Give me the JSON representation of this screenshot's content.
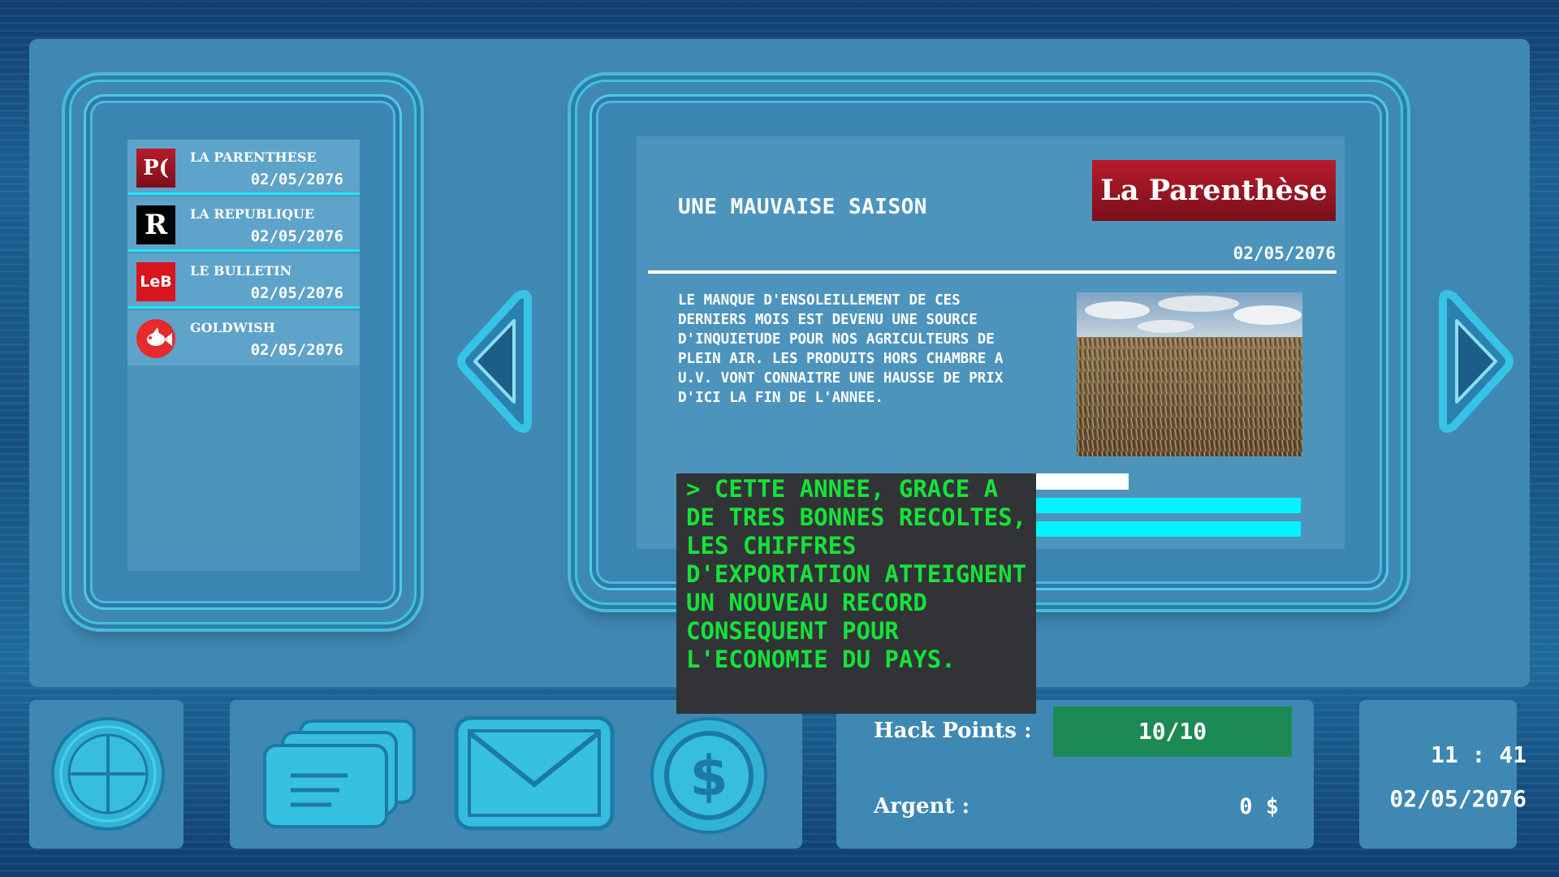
{
  "news_list": {
    "items": [
      {
        "name": "LA PARENTHESE",
        "date": "02/05/2076",
        "logo_text": "P(",
        "icon": "la-parenthese-logo-icon"
      },
      {
        "name": "LA REPUBLIQUE",
        "date": "02/05/2076",
        "logo_text": "R",
        "icon": "la-republique-logo-icon"
      },
      {
        "name": "LE BULLETIN",
        "date": "02/05/2076",
        "logo_text": "LeB",
        "icon": "le-bulletin-logo-icon"
      },
      {
        "name": "GOLDWISH",
        "date": "02/05/2076",
        "logo_text": "",
        "icon": "goldwish-fish-logo-icon"
      }
    ]
  },
  "article": {
    "headline": "UNE MAUVAISE SAISON",
    "paper": "La Parenthèse",
    "date": "02/05/2076",
    "body": "LE MANQUE D'ENSOLEILLEMENT DE CES DERNIERS MOIS EST DEVENU UNE SOURCE D'INQUIETUDE POUR NOS AGRICULTEURS DE PLEIN AIR. LES PRODUITS HORS CHAMBRE A U.V. VONT CONNAITRE UNE HAUSSE DE PRIX D'ICI LA FIN DE L'ANNEE."
  },
  "popup": {
    "text": "> CETTE ANNEE, GRACE A DE TRES BONNES RECOLTES, LES CHIFFRES D'EXPORTATION ATTEIGNENT UN NOUVEAU RECORD CONSEQUENT POUR L'ECONOMIE DU PAYS."
  },
  "navigation": {
    "prev_icon": "left-arrow-icon",
    "next_icon": "right-arrow-icon"
  },
  "toolbar": {
    "icons": [
      "target-icon",
      "news-stack-icon",
      "mail-icon",
      "dollar-coin-icon"
    ]
  },
  "stats": {
    "hack_label": "Hack Points :",
    "hack_value": "10/10",
    "money_label": "Argent :",
    "money_value": "0 $"
  },
  "clock": {
    "time": "11 : 41",
    "date": "02/05/2076"
  },
  "colors": {
    "accent_cyan": "#00f4ff",
    "popup_text": "#16e23a",
    "hack_box": "#1c8a55",
    "paper_logo_red": "#b71c2c"
  }
}
